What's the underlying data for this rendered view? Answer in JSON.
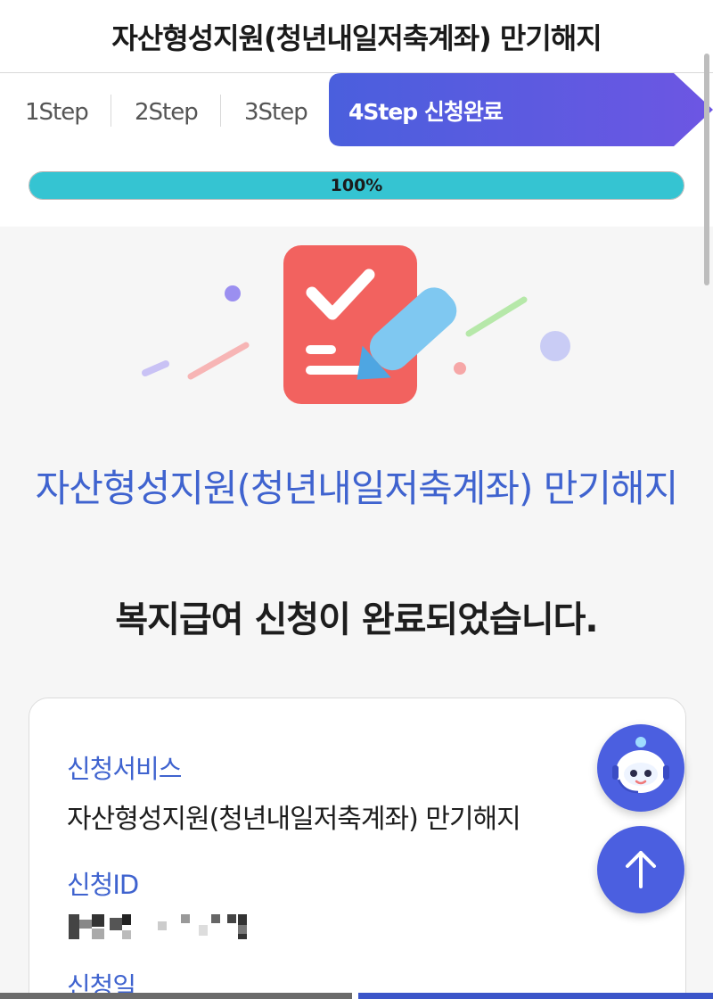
{
  "header": {
    "title": "자산형성지원(청년내일저축계좌) 만기해지"
  },
  "steps": {
    "items": [
      {
        "label": "1Step"
      },
      {
        "label": "2Step"
      },
      {
        "label": "3Step"
      }
    ],
    "active_label": "4Step 신청완료",
    "active_color": "#4b5fe0"
  },
  "progress": {
    "label": "100%",
    "value": 1.0,
    "fill_color": "#35c4d2"
  },
  "main": {
    "title": "자산형성지원(청년내일저축계좌) 만기해지",
    "subtitle": "복지급여 신청이 완료되었습니다."
  },
  "card": {
    "service_label": "신청서비스",
    "service_value": "자산형성지원(청년내일저축계좌) 만기해지",
    "id_label": "신청ID",
    "date_label": "신청일"
  },
  "colors": {
    "accent": "#3f63cf",
    "fab": "#4b5fe0",
    "icon_red": "#f0625f"
  },
  "icons": [
    "check-document-icon",
    "chatbot-icon",
    "arrow-up-icon"
  ]
}
